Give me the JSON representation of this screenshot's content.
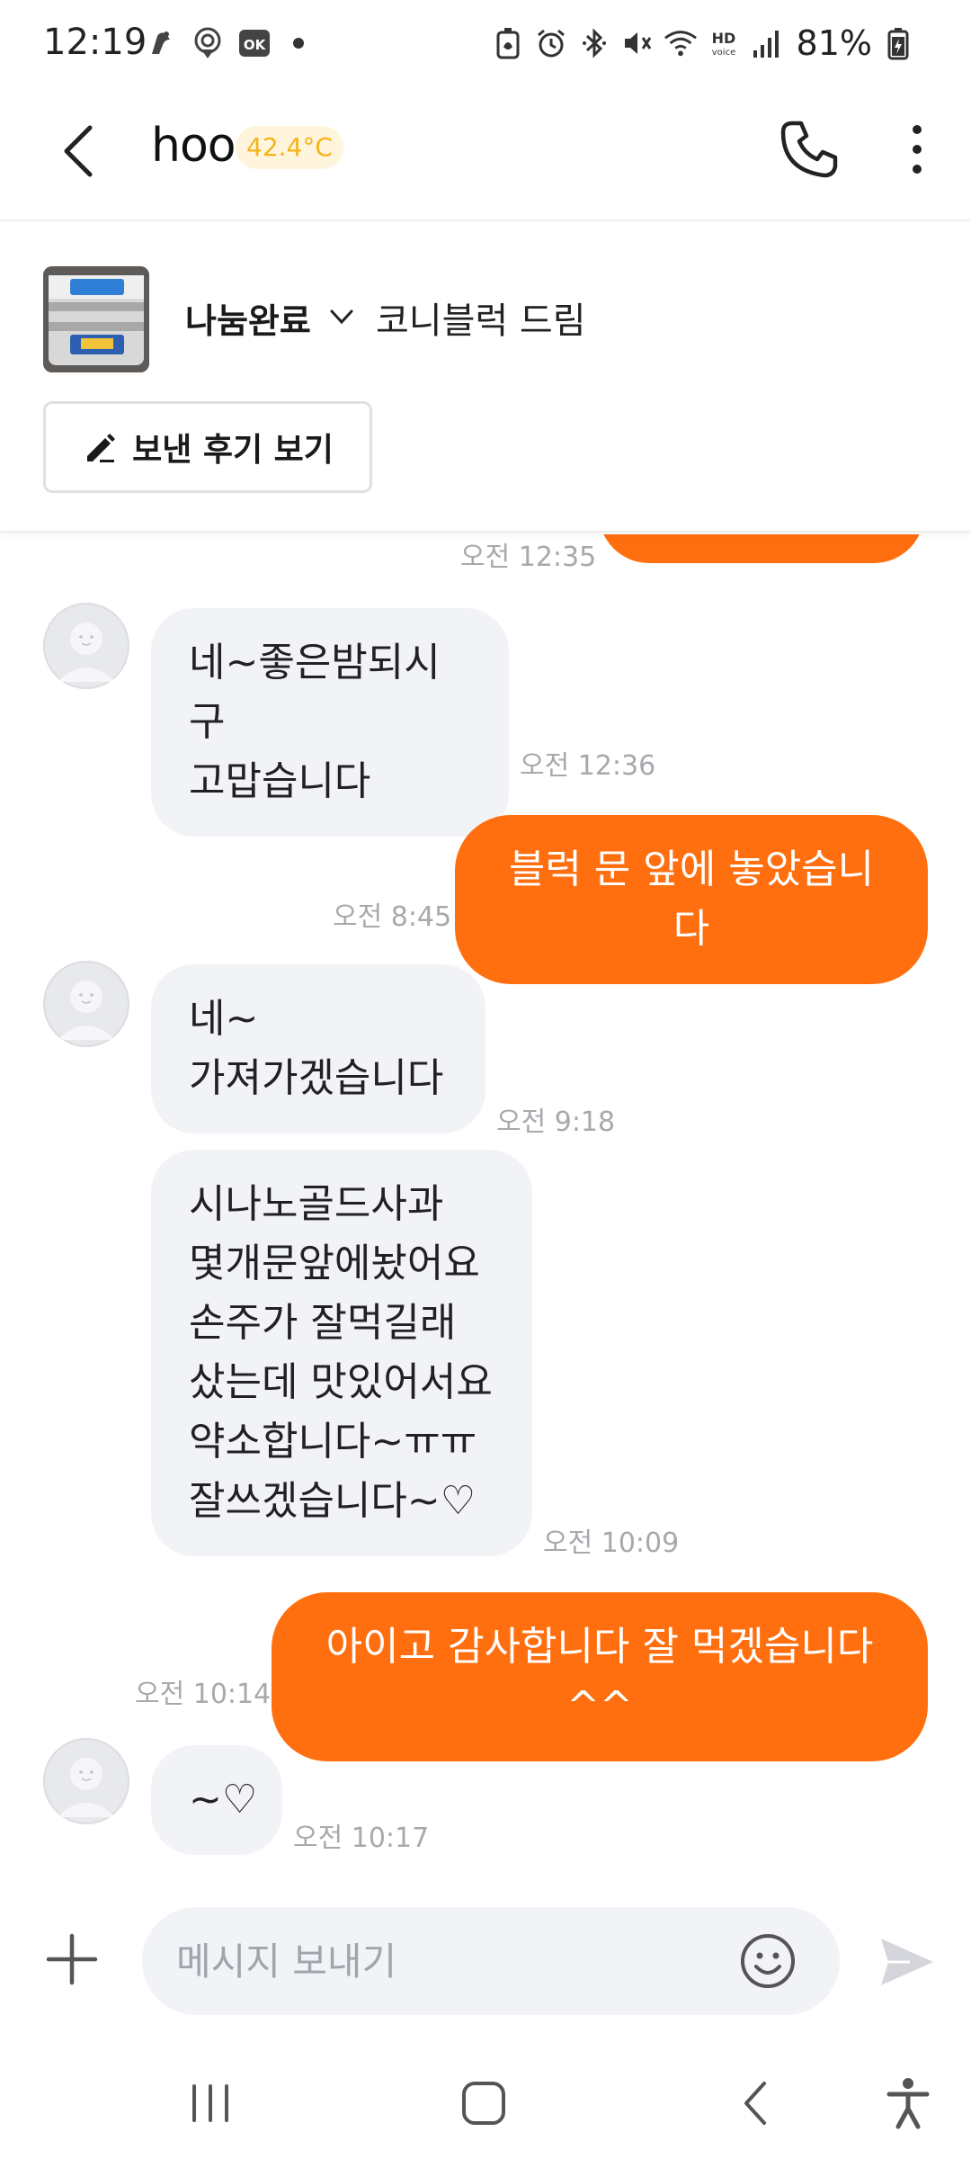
{
  "status_bar": {
    "time": "12:19",
    "battery_percent": "81%",
    "left_icons": [
      "karrot-notification-icon",
      "location-pin-icon",
      "ok-cashbag-icon",
      "notification-dot"
    ],
    "right_icons": [
      "battery-saver-icon",
      "alarm-icon",
      "bluetooth-icon",
      "mute-icon",
      "wifi-icon",
      "hd-voice-icon",
      "signal-icon",
      "battery-icon"
    ]
  },
  "header": {
    "nickname": "hoo",
    "manner_temperature": "42.4°C"
  },
  "product": {
    "status": "나눔완료",
    "title": "코니블럭 드림",
    "review_button": "보낸 후기 보기"
  },
  "messages": [
    {
      "direction": "out",
      "text": "",
      "time": "오전 12:35"
    },
    {
      "direction": "in",
      "text": "네~좋은밤되시구\n고맙습니다",
      "time": "오전 12:36"
    },
    {
      "direction": "out",
      "text": "블럭 문 앞에 놓았습니다",
      "time": "오전 8:45"
    },
    {
      "direction": "in",
      "text": "네~\n가져가겠습니다",
      "time": "오전 9:18"
    },
    {
      "direction": "in",
      "text": "시나노골드사과\n몇개문앞에놨어요\n손주가 잘먹길래\n샀는데 맛있어서요\n약소합니다~ㅠㅠ\n잘쓰겠습니다~♡",
      "time": "오전 10:09"
    },
    {
      "direction": "out",
      "text": "아이고 감사합니다 잘 먹겠습니다^^",
      "time": "오전 10:14"
    },
    {
      "direction": "in",
      "text": "~♡",
      "time": "오전 10:17"
    }
  ],
  "input": {
    "placeholder": "메시지 보내기"
  },
  "colors": {
    "brand_orange": "#ff6f0f",
    "incoming_bubble": "#f2f3f6",
    "temperature_text": "#f5b416"
  }
}
